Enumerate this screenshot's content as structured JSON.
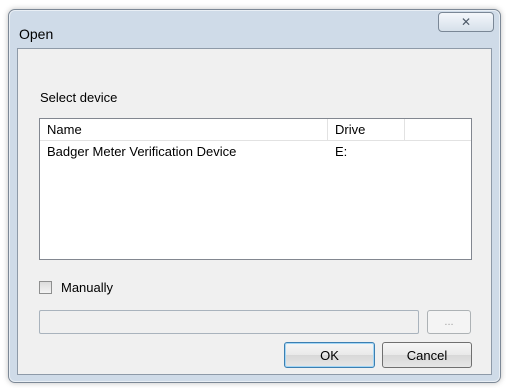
{
  "dialog": {
    "title": "Open",
    "close_glyph": "✕"
  },
  "section": {
    "label": "Select device"
  },
  "device_list": {
    "columns": [
      "Name",
      "Drive",
      ""
    ],
    "rows": [
      {
        "name": "Badger Meter Verification Device",
        "drive": "E:"
      }
    ]
  },
  "manual": {
    "label": "Manually",
    "checked": false
  },
  "path_field": {
    "value": "",
    "enabled": false
  },
  "browse_button": {
    "label": "..."
  },
  "buttons": {
    "ok": "OK",
    "cancel": "Cancel"
  },
  "icons": {
    "close": "close-icon"
  }
}
